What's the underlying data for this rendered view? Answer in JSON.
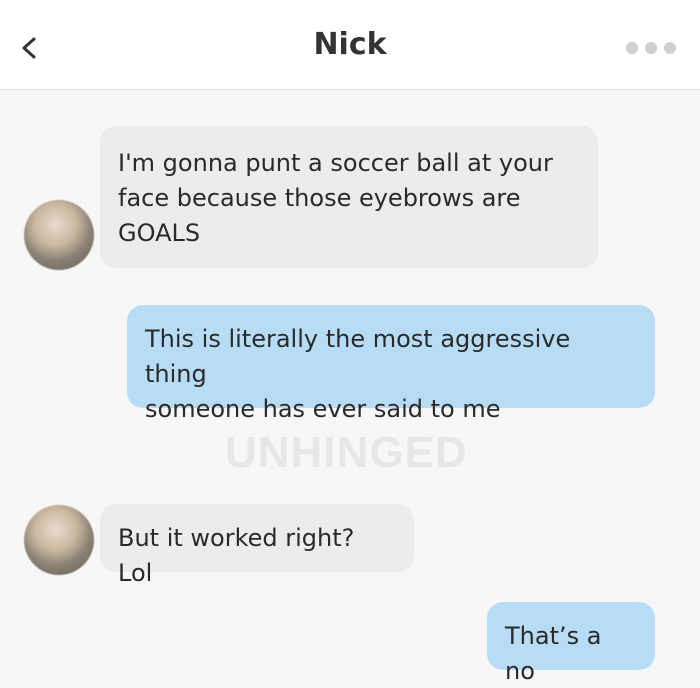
{
  "header": {
    "title": "Nick"
  },
  "watermark": "UNHINGED",
  "messages": [
    {
      "direction": "incoming",
      "lines": [
        "I'm gonna punt a soccer ball at your",
        "face because those eyebrows are",
        "GOALS"
      ]
    },
    {
      "direction": "outgoing",
      "lines": [
        "This is literally the most aggressive thing",
        "someone has ever said to me"
      ]
    },
    {
      "direction": "incoming",
      "lines": [
        "But it worked right? Lol"
      ]
    },
    {
      "direction": "outgoing",
      "lines": [
        "That’s a no"
      ]
    }
  ],
  "colors": {
    "incoming_bubble": "#ececec",
    "outgoing_bubble": "#b7ddf6",
    "background": "#f7f7f7",
    "header": "#ffffff"
  },
  "icons": {
    "back": "chevron-left-icon",
    "more": "more-dots-icon"
  }
}
